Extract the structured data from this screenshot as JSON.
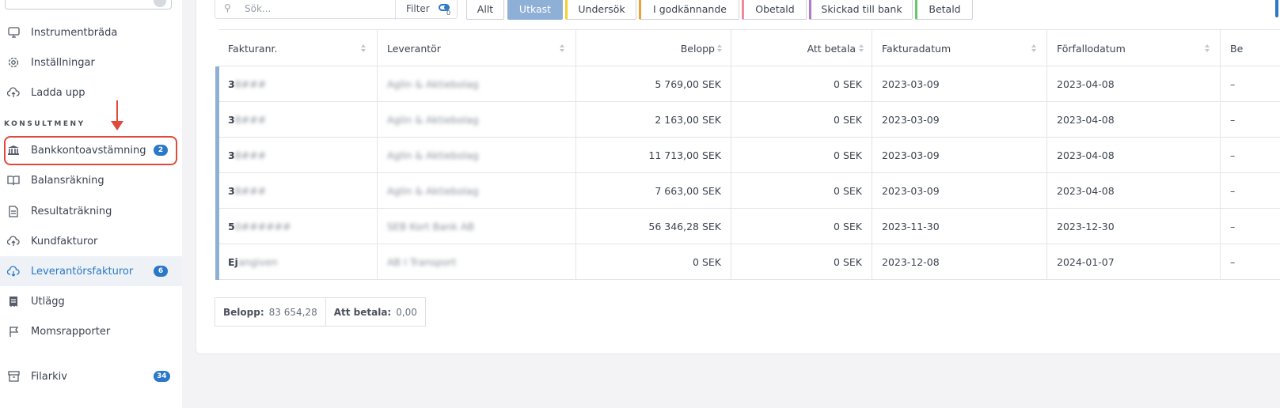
{
  "sidebar": {
    "items": [
      {
        "label": "Instrumentbräda",
        "icon": "monitor-icon"
      },
      {
        "label": "Inställningar",
        "icon": "gear-icon"
      },
      {
        "label": "Ladda upp",
        "icon": "cloud-upload-icon"
      },
      {
        "label": "Bankkontoavstämning",
        "icon": "bank-icon",
        "badge": "2"
      },
      {
        "label": "Balansräkning",
        "icon": "book-icon"
      },
      {
        "label": "Resultaträkning",
        "icon": "document-icon"
      },
      {
        "label": "Kundfakturor",
        "icon": "cloud-upload-icon"
      },
      {
        "label": "Leverantörsfakturor",
        "icon": "cloud-download-icon",
        "badge": "6",
        "active": true
      },
      {
        "label": "Utlägg",
        "icon": "receipt-icon"
      },
      {
        "label": "Momsrapporter",
        "icon": "flag-icon"
      },
      {
        "label": "Filarkiv",
        "icon": "archive-icon",
        "badge": "34"
      }
    ],
    "section_label": "KONSULTMENY"
  },
  "toolbar": {
    "search_placeholder": "Sök...",
    "filter_label": "Filter",
    "filter_count": "0",
    "segments": [
      {
        "label": "Allt",
        "color": "#cfd3d9"
      },
      {
        "label": "Utkast",
        "color": "#8fb0d6",
        "active": true
      },
      {
        "label": "Undersök",
        "color": "#f2d230"
      },
      {
        "label": "I godkännande",
        "color": "#f0a030"
      },
      {
        "label": "Obetald",
        "color": "#f08a9a"
      },
      {
        "label": "Skickad till bank",
        "color": "#b07cc8"
      },
      {
        "label": "Betald",
        "color": "#6cc76c"
      }
    ]
  },
  "table": {
    "headers": [
      "Fakturanr.",
      "Leverantör",
      "Belopp",
      "Att betala",
      "Fakturadatum",
      "Förfallodatum",
      "Be"
    ],
    "rows": [
      {
        "nr_prefix": "3",
        "nr_rest": "8###",
        "supplier": "Aglin & Aktiebolag",
        "amount": "5 769,00 SEK",
        "to_pay": "0 SEK",
        "inv_date": "2023-03-09",
        "due_date": "2023-04-08",
        "extra": "–"
      },
      {
        "nr_prefix": "3",
        "nr_rest": "8###",
        "supplier": "Aglin & Aktiebolag",
        "amount": "2 163,00 SEK",
        "to_pay": "0 SEK",
        "inv_date": "2023-03-09",
        "due_date": "2023-04-08",
        "extra": "–"
      },
      {
        "nr_prefix": "3",
        "nr_rest": "8###",
        "supplier": "Aglin & Aktiebolag",
        "amount": "11 713,00 SEK",
        "to_pay": "0 SEK",
        "inv_date": "2023-03-09",
        "due_date": "2023-04-08",
        "extra": "–"
      },
      {
        "nr_prefix": "3",
        "nr_rest": "8###",
        "supplier": "Aglin & Aktiebolag",
        "amount": "7 663,00 SEK",
        "to_pay": "0 SEK",
        "inv_date": "2023-03-09",
        "due_date": "2023-04-08",
        "extra": "–"
      },
      {
        "nr_prefix": "5",
        "nr_rest": "0######",
        "supplier": "SEB Kort Bank AB",
        "amount": "56 346,28 SEK",
        "to_pay": "0 SEK",
        "inv_date": "2023-11-30",
        "due_date": "2023-12-30",
        "extra": "–"
      },
      {
        "nr_prefix": "Ej",
        "nr_rest": "angiven",
        "supplier": "AB I Transport",
        "amount": "0 SEK",
        "to_pay": "0 SEK",
        "inv_date": "2023-12-08",
        "due_date": "2024-01-07",
        "extra": "–"
      }
    ]
  },
  "totals": {
    "amount_label": "Belopp:",
    "amount_value": "83 654,28",
    "to_pay_label": "Att betala:",
    "to_pay_value": "0,00"
  }
}
